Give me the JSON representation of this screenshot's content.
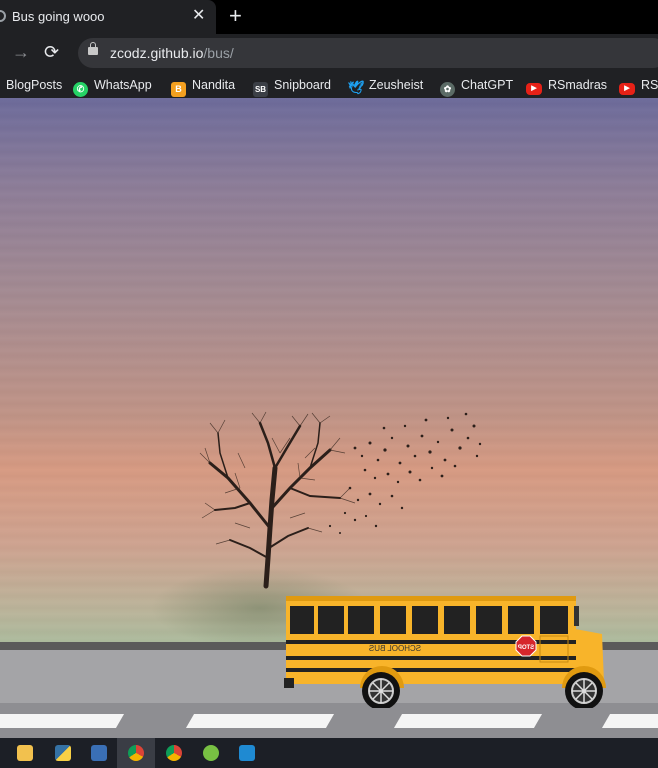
{
  "browser": {
    "tab": {
      "title": "Bus going wooo",
      "close_label": "✕",
      "icon": "globe-icon"
    },
    "new_tab_label": "+",
    "nav": {
      "forward_label": "→",
      "reload_label": "⟳"
    },
    "address": {
      "host": "zcodz.github.io",
      "path": "/bus/"
    },
    "bookmarks": [
      {
        "label": "BlogPosts",
        "icon": "none"
      },
      {
        "label": "WhatsApp",
        "icon": "whatsapp-icon"
      },
      {
        "label": "Nandita",
        "icon": "blogger-icon"
      },
      {
        "label": "Snipboard",
        "icon": "snipboard-icon"
      },
      {
        "label": "Zeusheist",
        "icon": "twitter-icon"
      },
      {
        "label": "ChatGPT",
        "icon": "chatgpt-icon"
      },
      {
        "label": "RSmadras",
        "icon": "youtube-icon"
      },
      {
        "label": "RSe",
        "icon": "youtube-icon"
      }
    ]
  },
  "scene": {
    "bus": {
      "sign_text": "SCHOOL BUS",
      "stop_text": "STOP",
      "color": "#f8b42a"
    },
    "colors": {
      "sky_top": "#6d6b9b",
      "sky_glow": "#d79a82",
      "road": "#a4a4a7"
    }
  },
  "taskbar": {
    "apps": [
      "file-explorer-icon",
      "python-icon",
      "bandicam-icon",
      "chrome-icon",
      "chrome-icon",
      "utorrent-icon",
      "vscode-icon"
    ],
    "active_index": 3
  }
}
